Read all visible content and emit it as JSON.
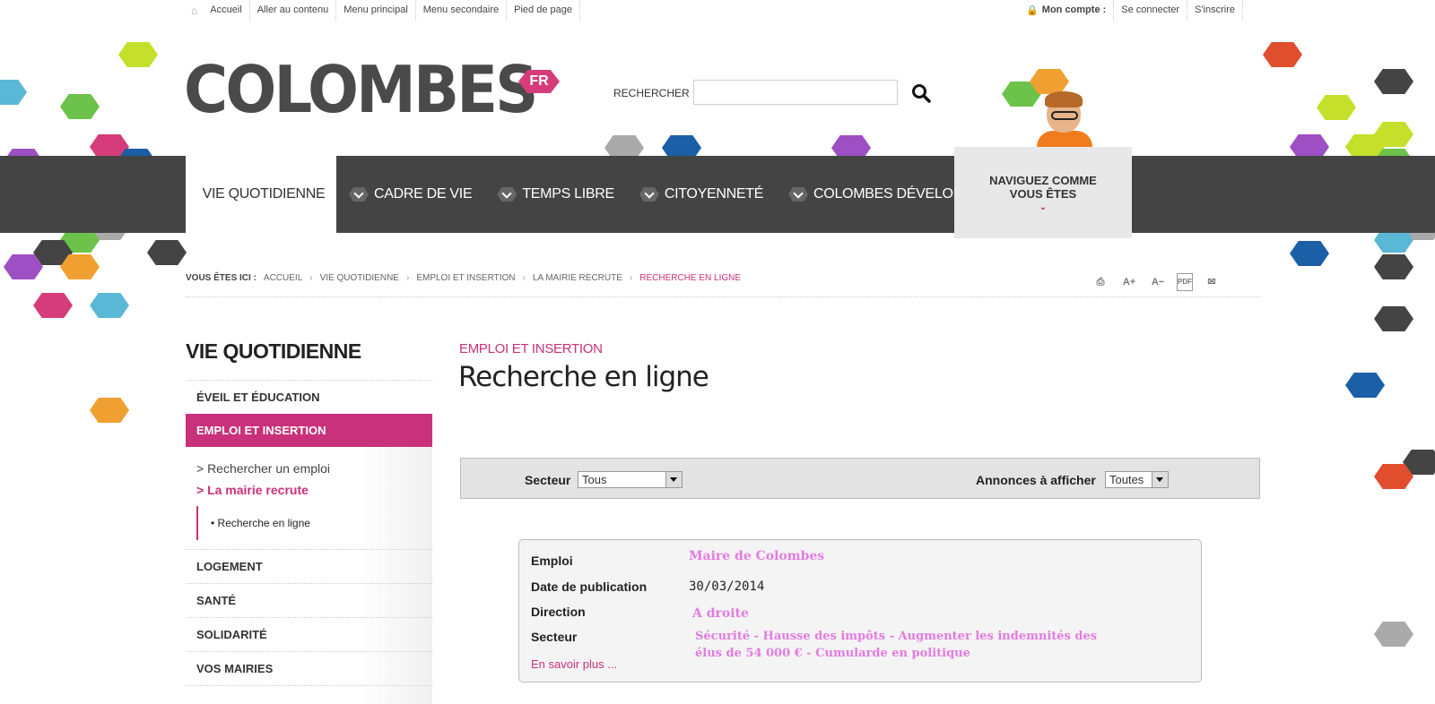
{
  "colors": {
    "accent": "#c9317a",
    "nav_bg": "#444444",
    "highlight_pink": "#e27be0"
  },
  "top_links": [
    "Accueil",
    "Aller au contenu",
    "Menu principal",
    "Menu secondaire",
    "Pied de page"
  ],
  "account": {
    "label": "Mon compte :",
    "login": "Se connecter",
    "signup": "S'inscrire"
  },
  "logo": {
    "text": "COLOMBES",
    "badge": "FR"
  },
  "search": {
    "label": "RECHERCHER :",
    "value": ""
  },
  "nav": {
    "items": [
      "VIE QUOTIDIENNE",
      "CADRE DE VIE",
      "TEMPS LIBRE",
      "CITOYENNETÉ",
      "COLOMBES DÉVELOPPEMENT"
    ],
    "naviguez": "NAVIGUEZ COMME VOUS ÊTES"
  },
  "breadcrumb": {
    "prefix": "VOUS ÊTES ICI :",
    "items": [
      "ACCUEIL",
      "VIE QUOTIDIENNE",
      "EMPLOI ET INSERTION",
      "LA MAIRIE RECRUTE",
      "RECHERCHE EN LIGNE"
    ]
  },
  "tools": [
    "print-icon",
    "font-increase-icon",
    "font-decrease-icon",
    "pdf-icon",
    "email-icon"
  ],
  "sidebar": {
    "title": "VIE QUOTIDIENNE",
    "items": [
      "ÉVEIL ET ÉDUCATION",
      "EMPLOI ET INSERTION",
      "LOGEMENT",
      "SANTÉ",
      "SOLIDARITÉ",
      "VOS MAIRIES"
    ],
    "sub": [
      "> Rechercher un emploi",
      "> La mairie recrute"
    ],
    "subsub": "Recherche en ligne"
  },
  "main": {
    "kicker": "EMPLOI ET INSERTION",
    "title": "Recherche en ligne",
    "filter": {
      "secteur_label": "Secteur",
      "secteur_value": "Tous",
      "annonces_label": "Annonces à afficher",
      "annonces_value": "Toutes"
    },
    "card": {
      "emploi_label": "Emploi",
      "emploi_value": "Maire de Colombes",
      "date_label": "Date de publication",
      "date_value": "30/03/2014",
      "direction_label": "Direction",
      "direction_value": "A droite",
      "secteur_label": "Secteur",
      "secteur_line1": "Sécurité - Hausse des impôts - Augmenter les indemnités des",
      "secteur_line2": "élus de 54 000 € - Cumularde en politique",
      "more": "En savoir plus ..."
    }
  }
}
